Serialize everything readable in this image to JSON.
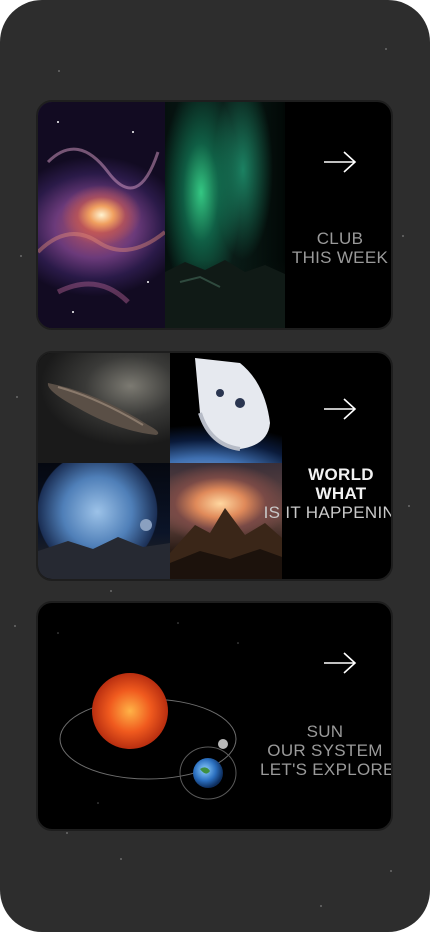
{
  "cards": [
    {
      "id": "club",
      "title_lines": [
        "CLUB",
        "THIS WEEK"
      ],
      "images": [
        "nebula",
        "aurora"
      ]
    },
    {
      "id": "world",
      "title_lines": [
        "WORLD",
        "WHAT",
        "IS IT HAPPENING?"
      ],
      "images": [
        "asteroid",
        "spacecraft",
        "planet-moon",
        "mountain-sunrise"
      ]
    },
    {
      "id": "sun",
      "title_lines": [
        "SUN",
        "OUR SYSTEM",
        "LET'S EXPLORE"
      ],
      "images": [
        "solar-system"
      ]
    }
  ],
  "icons": {
    "arrow": "arrow-right-icon"
  },
  "colors": {
    "background": "#2d2d2d",
    "card": "#000000",
    "text_muted": "#9a9a9a",
    "text_bright": "#f2f2f2"
  }
}
